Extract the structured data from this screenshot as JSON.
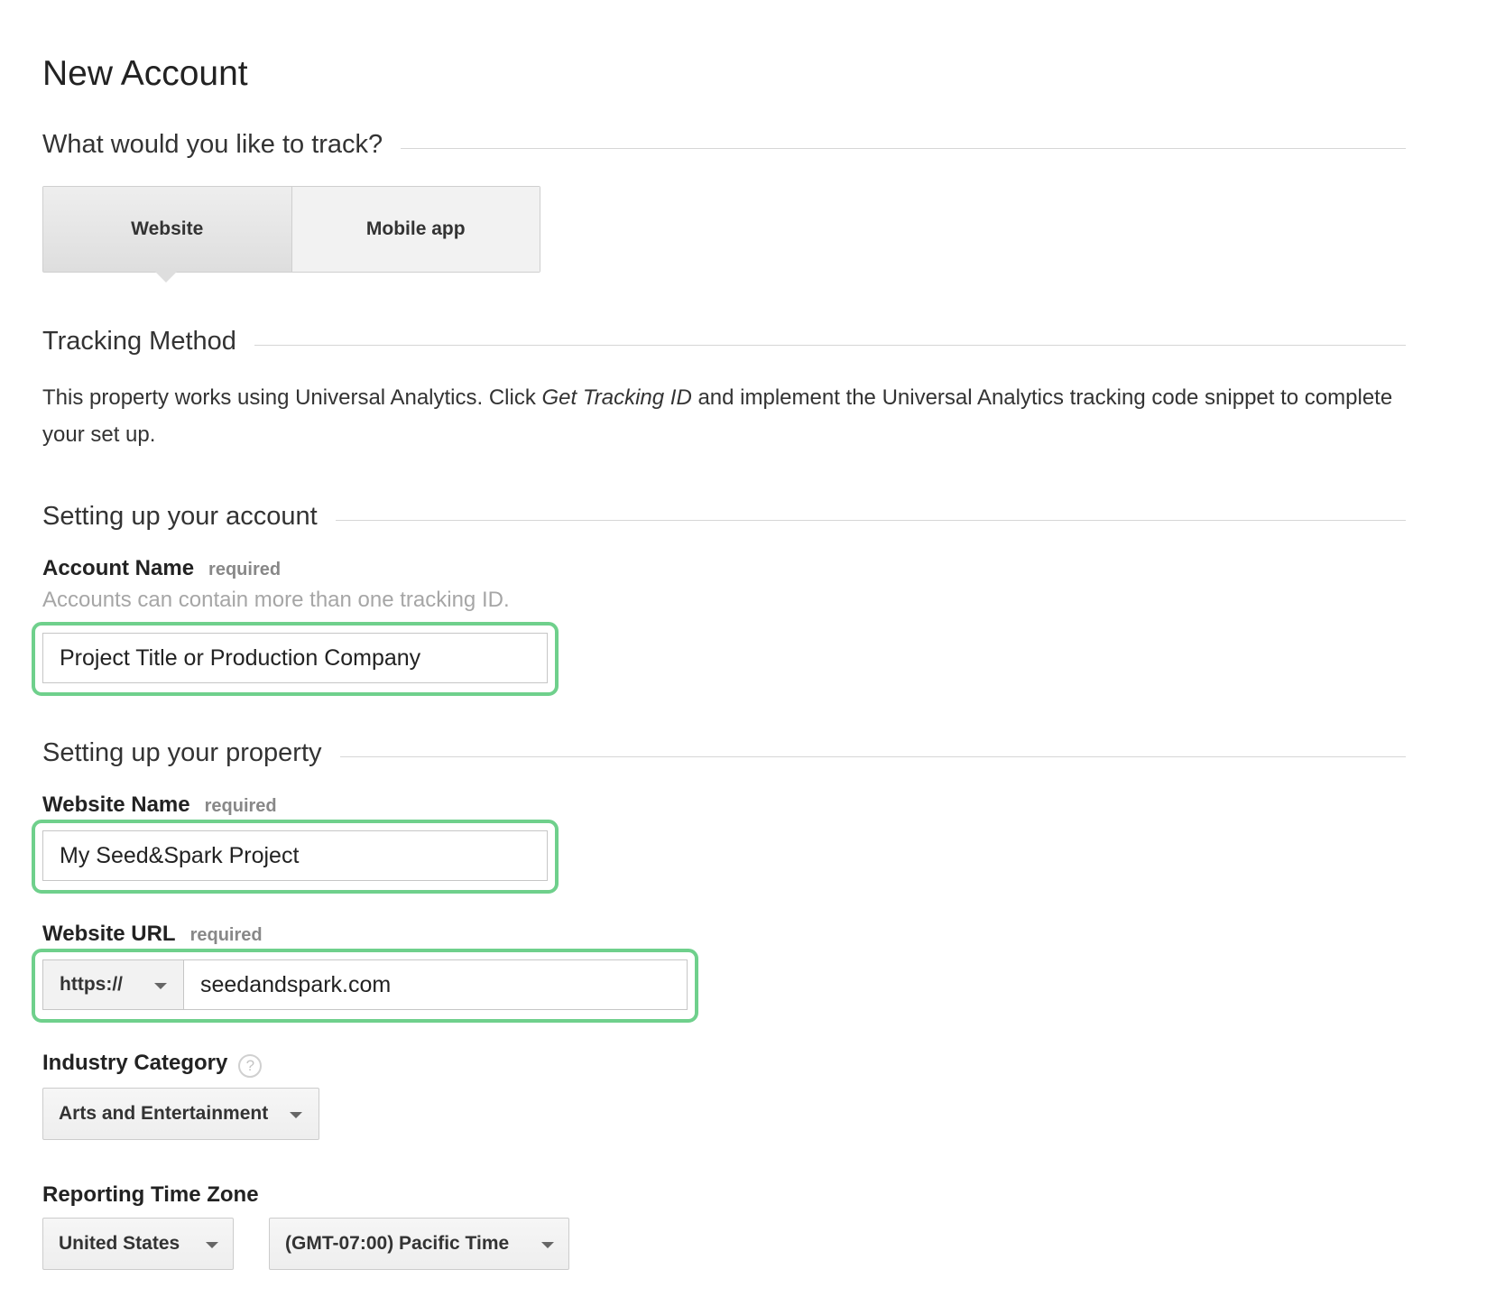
{
  "page": {
    "title": "New Account"
  },
  "track_section": {
    "heading": "What would you like to track?",
    "options": [
      {
        "label": "Website",
        "selected": true
      },
      {
        "label": "Mobile app",
        "selected": false
      }
    ]
  },
  "tracking_method": {
    "heading": "Tracking Method",
    "text_before": "This property works using Universal Analytics. Click ",
    "text_emphasis": "Get Tracking ID",
    "text_after": " and implement the Universal Analytics tracking code snippet to complete your set up."
  },
  "account_section": {
    "heading": "Setting up your account",
    "account_name": {
      "label": "Account Name",
      "required": "required",
      "hint": "Accounts can contain more than one tracking ID.",
      "value": "Project Title or Production Company"
    }
  },
  "property_section": {
    "heading": "Setting up your property",
    "website_name": {
      "label": "Website Name",
      "required": "required",
      "value": "My Seed&Spark Project"
    },
    "website_url": {
      "label": "Website URL",
      "required": "required",
      "protocol": "https://",
      "value": "seedandspark.com"
    },
    "industry_category": {
      "label": "Industry Category",
      "help_icon": "?",
      "value": "Arts and Entertainment"
    },
    "time_zone": {
      "label": "Reporting Time Zone",
      "country": "United States",
      "zone": "(GMT-07:00) Pacific Time"
    }
  },
  "colors": {
    "highlight": "#6fd08c",
    "rule": "#d6d6d6",
    "hint_text": "#a6a6a6"
  }
}
